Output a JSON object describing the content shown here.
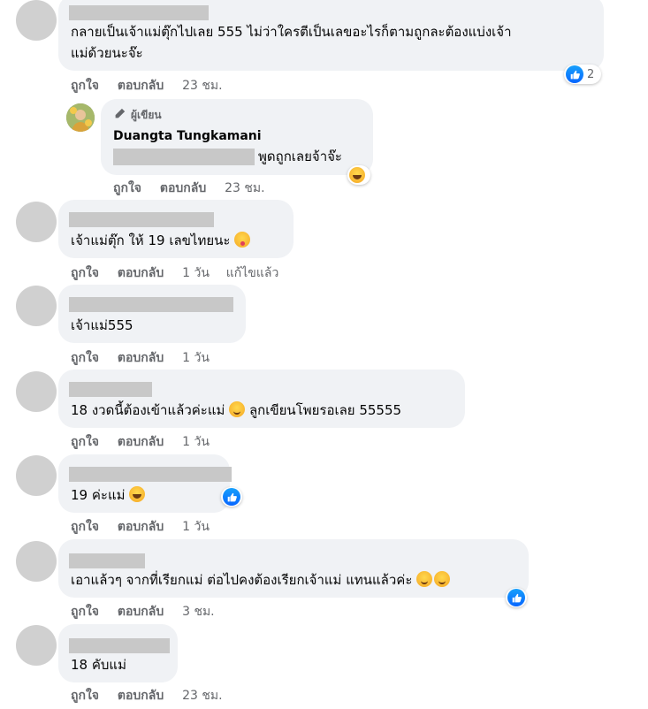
{
  "common": {
    "like_label": "ถูกใจ",
    "reply_label": "ตอบกลับ",
    "edited_label": "แก้ไขแล้ว"
  },
  "comments": [
    {
      "line1": "กลายเป็นเจ้าแม่ตุ๊กไปเลย 555 ไม่ว่าใครตีเป็นเลขอะไรก็ตามถูกละต้องแบ่งเจ้า",
      "line2": "แม่ด้วยนะจ๊ะ",
      "time": "23 ชม.",
      "like_count": "2"
    },
    {
      "text": "เจ้าแม่ตุ๊ก ให้ 19 เลขไทยนะ",
      "emoji": "winking-tongue-emoji",
      "time": "1 วัน"
    },
    {
      "text": "เจ้าแม่555",
      "time": "1 วัน"
    },
    {
      "text_before": "18 งวดนี้ต้องเข้าแล้วค่ะแม่",
      "text_after": "ลูกเขียนโพยรอเลย 55555",
      "emoji": "smile-emoji",
      "time": "1 วัน"
    },
    {
      "text": "19 ค่ะแม่",
      "emoji": "laughing-emoji",
      "time": "1 วัน"
    },
    {
      "text": "เอาแล้วๆ จากที่เรียกแม่ ต่อไปคงต้องเรียกเจ้าแม่ แทนแล้วค่ะ",
      "emoji": "blushing-smile-emoji",
      "time": "3 ชม."
    },
    {
      "text": "18 คับแม่",
      "time": "23 ชม."
    }
  ],
  "reply": {
    "author_badge": "ผู้เขียน",
    "author_name": "Duangta Tungkamani",
    "text": "พูดถูกเลยจ้าจ๊ะ",
    "reaction": "laughing-emoji",
    "time": "23 ชม."
  },
  "colors": {
    "bubble": "#f0f2f5",
    "placeholder": "#c8c8c8",
    "like_blue": "#0866ff",
    "meta_text": "#65676b"
  }
}
